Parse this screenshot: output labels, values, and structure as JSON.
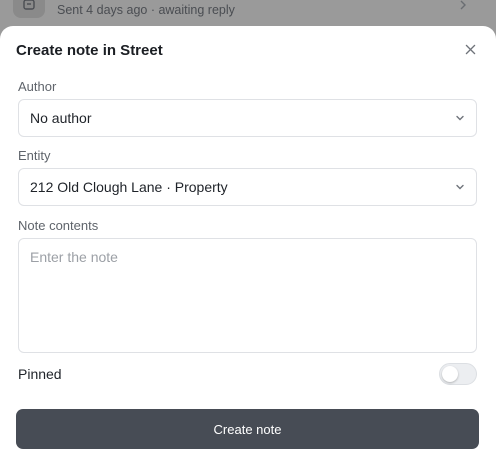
{
  "background_row": {
    "subtitle": "Sent 4 days ago · awaiting reply",
    "avatar_icon": "contact-icon",
    "chevron_icon": "chevron-right-icon"
  },
  "dialog": {
    "title": "Create note in Street",
    "close_icon": "close-icon"
  },
  "form": {
    "author": {
      "label": "Author",
      "value": "No author"
    },
    "entity": {
      "label": "Entity",
      "value": "212 Old Clough Lane · Property"
    },
    "note": {
      "label": "Note contents",
      "placeholder": "Enter the note",
      "value": ""
    },
    "pinned": {
      "label": "Pinned",
      "on": false
    }
  },
  "actions": {
    "submit_label": "Create note"
  },
  "colors": {
    "primary_button": "#474c55",
    "overlay": "#8c8c8c"
  }
}
